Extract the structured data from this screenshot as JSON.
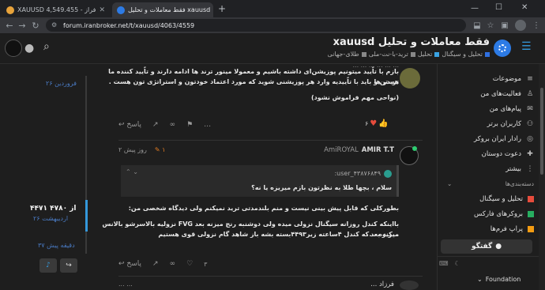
{
  "browser": {
    "tabs": [
      {
        "label": "XAUUSD 4,549.455 - فراز",
        "active": false
      },
      {
        "label": "فقط معاملات و تحلیل xauusd",
        "active": true
      }
    ],
    "url": "forum.iranbroker.net/t/xauusd/4063/4559",
    "new_tab_symbol": "+",
    "close_symbol": "✕"
  },
  "header": {
    "topic_title": "فقط معاملات و تحلیل xauusd",
    "breadcrumbs": [
      {
        "label": "تحلیل و سیگنال",
        "color": "#2f6fdf"
      },
      {
        "label": "تحلیل",
        "color": "#3aa3e3"
      },
      {
        "label": "ترید-با-نت-ملی",
        "color": "#888888"
      },
      {
        "label": "طلای-جهانی",
        "color": "#888888"
      }
    ]
  },
  "sidebar": {
    "items": [
      {
        "label": "موضوعات",
        "icon": "layers-icon"
      },
      {
        "label": "فعالیت‌های من",
        "icon": "user-icon"
      },
      {
        "label": "پیام‌های من",
        "icon": "inbox-icon"
      },
      {
        "label": "کاربران برتر",
        "icon": "users-icon"
      },
      {
        "label": "رادار ایران بروکر",
        "icon": "radar-icon"
      },
      {
        "label": "دعوت دوستان",
        "icon": "invite-icon"
      },
      {
        "label": "بیشتر",
        "icon": "more-icon"
      }
    ],
    "categories_header": "دسته‌بندی‌ها",
    "categories": [
      {
        "label": "تحلیل و سیگنال",
        "color": "#e74c3c"
      },
      {
        "label": "بروکرهای فارکس",
        "color": "#27ae60"
      },
      {
        "label": "پراپ فرم‌ها",
        "color": "#f39c12"
      }
    ],
    "chat_button": "گفتگو",
    "foundation_label": "Foundation"
  },
  "post1": {
    "line0": "... ... ... ... ... ...",
    "line1": "بازم با تاًیید میتونیم پوزیشن‌ای داشته باشیم و معمولا مینور ترند ها ادامه دارند و تاًیید کننده ما تریدر ها",
    "line2": "هستن و باید با تاًییدیه وارد هر پوزیشنی شوید که مورد اعتماد خودتون و استراتژی تون هست .",
    "line3": "(نواحی مهم فراموش نشود)",
    "likes": "۶",
    "reply_label": "پاسخ"
  },
  "post2": {
    "author_full": "AMIR T.T",
    "author_user": "AmiROYAL",
    "badge": "۱",
    "date": "۲ روز پیش",
    "quote_user": "user_۴۳۸۷۶۸۴۹:",
    "quote_text": "سلام ، بچها طلا به نظرتون بازم میریزه یا نه؟",
    "line1": "بطورکلی که قابل پیش بینی نیست و منم بلندمدتی ترید نمیکنم ولی دیدگاه شخصی من:",
    "line2": "بااینکه کندل روزانه سیگنال نزولی میده ولی دوشنبه رنج میزنه بعد FVG نزولیه بالاسرشو بالانس میکنه بعد",
    "line3": "میریزه ...که کندل ۴ساعته زیر۴۴۹۳بسته بشه باز شاهد گام نزولی قوی هستیم",
    "likes": "۳",
    "reply_label": "پاسخ"
  },
  "post3": {
    "author": "فرزاد ...",
    "date": "... ..."
  },
  "timeline": {
    "top_date": "۲۶ فروردین",
    "position": "۴۴۷۱ از ۴۷۸۰",
    "position_date": "۲۶ اردیبهشت",
    "bottom_date": "۳۷ دقیقه پیش"
  },
  "colors": {
    "accent": "#3498db",
    "like": "#e74c3c",
    "online": "#2ecc71"
  }
}
